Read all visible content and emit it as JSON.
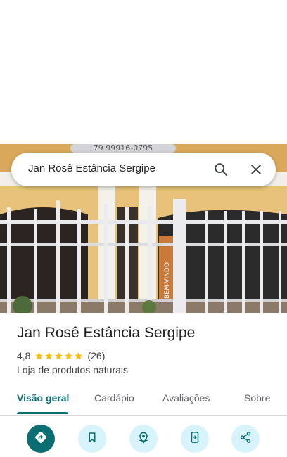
{
  "search": {
    "query": "Jan Rosê Estância Sergipe"
  },
  "place": {
    "name": "Jan Rosê Estância Sergipe",
    "rating": "4,8",
    "stars": 5,
    "review_count": "(26)",
    "category": "Loja de produtos naturais"
  },
  "tabs": [
    {
      "label": "Visão geral",
      "active": true
    },
    {
      "label": "Cardápio"
    },
    {
      "label": "Avaliações"
    },
    {
      "label": "Sobre"
    }
  ],
  "actions": [
    {
      "icon": "directions-icon",
      "primary": true
    },
    {
      "icon": "bookmark-icon"
    },
    {
      "icon": "nearby-icon"
    },
    {
      "icon": "send-to-phone-icon"
    },
    {
      "icon": "share-icon"
    }
  ],
  "photo": {
    "sign_text": "BEM-VINDO",
    "phone_text": "79 99916-0795"
  },
  "colors": {
    "accent": "#0b6e73",
    "star": "#fbbc04",
    "action_bg": "#d7f3fb"
  }
}
